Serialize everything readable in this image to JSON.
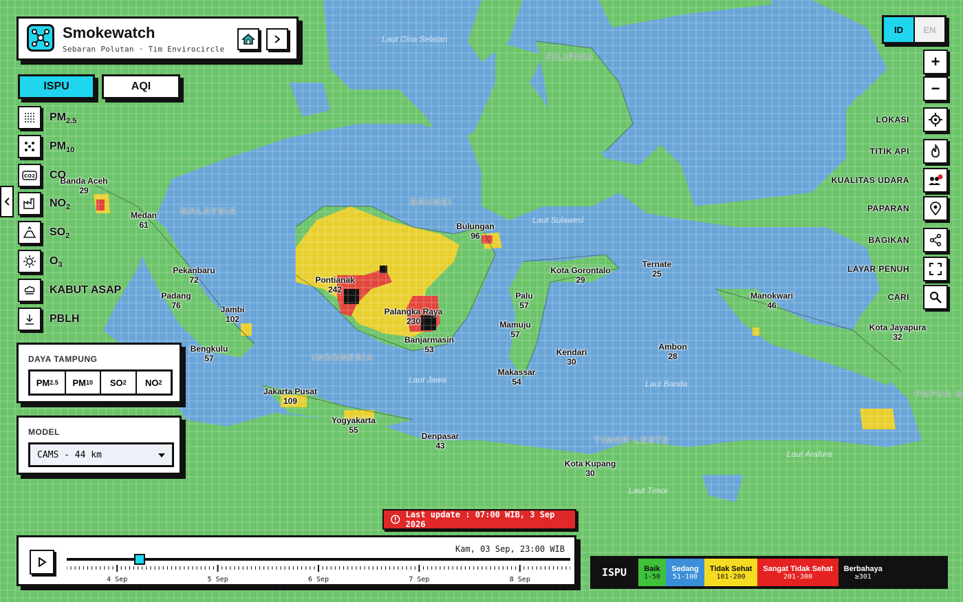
{
  "app": {
    "title": "Smokewatch",
    "subtitle": "Sebaran Polutan · Tim Envirocircle"
  },
  "tabs": [
    {
      "label": "ISPU",
      "active": true
    },
    {
      "label": "AQI",
      "active": false
    }
  ],
  "pollutants": [
    {
      "label": "PM",
      "sub": "2.5",
      "icon": "grid-dots-icon"
    },
    {
      "label": "PM",
      "sub": "10",
      "icon": "scatter-dots-icon"
    },
    {
      "label": "CO",
      "sub": "",
      "icon": "co2-icon"
    },
    {
      "label": "NO",
      "sub": "2",
      "icon": "factory-icon"
    },
    {
      "label": "SO",
      "sub": "2",
      "icon": "volcano-icon"
    },
    {
      "label": "O",
      "sub": "3",
      "icon": "sun-icon"
    },
    {
      "label": "KABUT ASAP",
      "sub": "",
      "icon": "smoke-cloud-icon"
    },
    {
      "label": "PBLH",
      "sub": "",
      "icon": "download-arrow-icon"
    }
  ],
  "daya_tampung": {
    "title": "DAYA TAMPUNG",
    "options": [
      {
        "label": "PM",
        "sub": "2.5"
      },
      {
        "label": "PM",
        "sub": "10"
      },
      {
        "label": "SO",
        "sub": "2"
      },
      {
        "label": "NO",
        "sub": "2"
      }
    ]
  },
  "model": {
    "title": "MODEL",
    "selected": "CAMS - 44 km"
  },
  "language": {
    "options": [
      "ID",
      "EN"
    ],
    "active": "ID"
  },
  "zoom": {
    "in": "+",
    "out": "−"
  },
  "tools": [
    {
      "label": "LOKASI",
      "icon": "crosshair-icon"
    },
    {
      "label": "TITIK API",
      "icon": "fire-icon"
    },
    {
      "label": "KUALITAS UDARA",
      "icon": "people-alert-icon"
    },
    {
      "label": "PAPARAN",
      "icon": "location-pin-icon"
    },
    {
      "label": "BAGIKAN",
      "icon": "share-icon"
    },
    {
      "label": "LAYAR PENUH",
      "icon": "fullscreen-icon"
    },
    {
      "label": "CARI",
      "icon": "search-icon"
    }
  ],
  "cities": [
    {
      "name": "Banda Aceh",
      "value": "29"
    },
    {
      "name": "Medan",
      "value": "61"
    },
    {
      "name": "Pekanbaru",
      "value": "72"
    },
    {
      "name": "Padang",
      "value": "76"
    },
    {
      "name": "Jambi",
      "value": "102"
    },
    {
      "name": "Bengkulu",
      "value": "57"
    },
    {
      "name": "Jakarta Pusat",
      "value": "109"
    },
    {
      "name": "Yogyakarta",
      "value": "55"
    },
    {
      "name": "Pontianak",
      "value": "242"
    },
    {
      "name": "Palangka Raya",
      "value": "230"
    },
    {
      "name": "Banjarmasin",
      "value": "53"
    },
    {
      "name": "Denpasar",
      "value": "43"
    },
    {
      "name": "Bulungan",
      "value": "96"
    },
    {
      "name": "Kota Gorontalo",
      "value": "29"
    },
    {
      "name": "Palu",
      "value": "57"
    },
    {
      "name": "Mamuju",
      "value": "57"
    },
    {
      "name": "Makassar",
      "value": "54"
    },
    {
      "name": "Kendari",
      "value": "30"
    },
    {
      "name": "Kota Kupang",
      "value": "30"
    },
    {
      "name": "Ternate",
      "value": "25"
    },
    {
      "name": "Ambon",
      "value": "28"
    },
    {
      "name": "Manokwari",
      "value": "46"
    },
    {
      "name": "Kota Jayapura",
      "value": "32"
    }
  ],
  "seas": [
    "Laut Cina Selatan",
    "Laut Sulawesi",
    "Laut Jawa",
    "Laut Banda",
    "Laut Arafura",
    "Laut Timor"
  ],
  "countries": [
    "FILIPINA",
    "MALAYSIA",
    "BRUNEI",
    "INDONESIA",
    "TIMOR LESTE",
    "PAPUA N"
  ],
  "update": {
    "text": "Last update : 07:00 WIB, 3 Sep 2026"
  },
  "timeline": {
    "readout": "Kam, 03 Sep, 23:00 WIB",
    "days": [
      "4 Sep",
      "5 Sep",
      "6 Sep",
      "7 Sep",
      "8 Sep"
    ],
    "position": 0.145
  },
  "legend": {
    "title": "ISPU",
    "items": [
      {
        "label": "Baik",
        "range": "1-50",
        "color": "#3ec23a"
      },
      {
        "label": "Sedang",
        "range": "51-100",
        "color": "#3a8fd8"
      },
      {
        "label": "Tidak Sehat",
        "range": "101-200",
        "color": "#f5dc22"
      },
      {
        "label": "Sangat Tidak Sehat",
        "range": "201-300",
        "color": "#e52222"
      },
      {
        "label": "Berbahaya",
        "range": "≥301",
        "color": "#111111"
      }
    ]
  },
  "colors": {
    "land": "#6cc46a",
    "sea": "#6aa5d8",
    "accent": "#20d6ef",
    "yellow": "#e8cf2e",
    "red": "#e2463c"
  }
}
